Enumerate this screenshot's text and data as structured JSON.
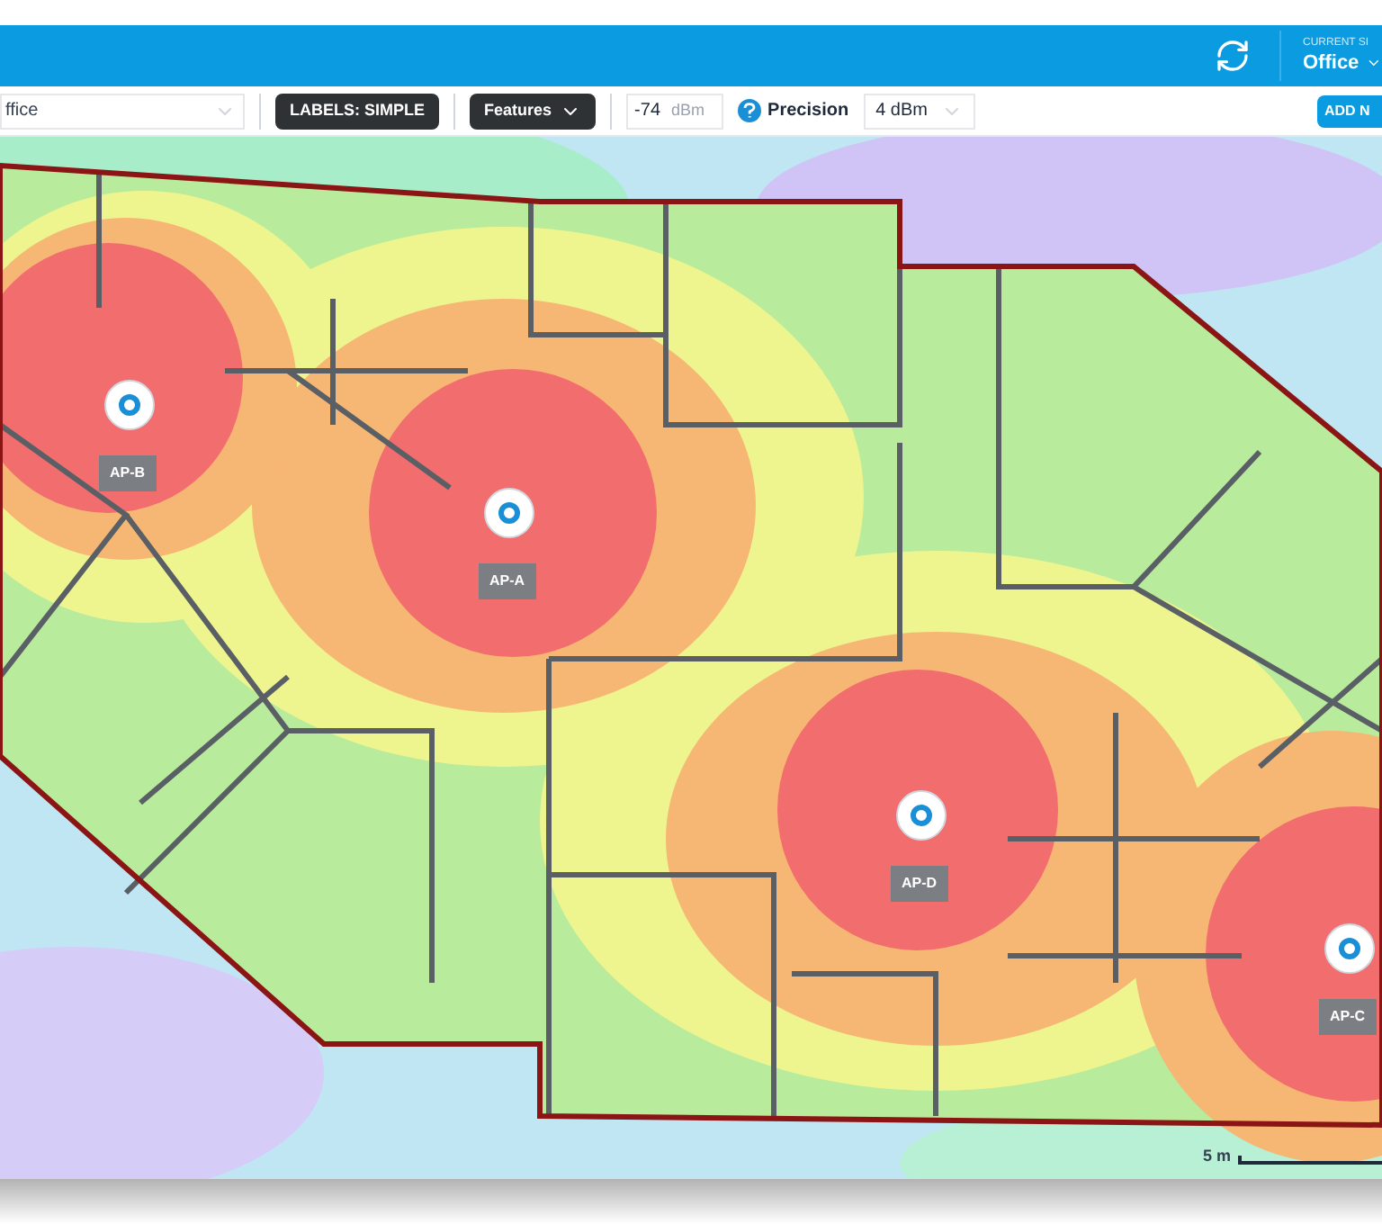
{
  "header": {
    "site_label": "CURRENT SI",
    "site_name": "Office"
  },
  "toolbar": {
    "map_select": "ffice",
    "labels_button": "LABELS: SIMPLE",
    "features_button": "Features",
    "signal_value": "-74",
    "signal_unit": "dBm",
    "precision_label": "Precision",
    "precision_value": "4 dBm",
    "add_button": "ADD N"
  },
  "access_points": [
    {
      "label": "AP-B"
    },
    {
      "label": "AP-A"
    },
    {
      "label": "AP-D"
    },
    {
      "label": "AP-C"
    }
  ],
  "scale": {
    "label": "5 m"
  }
}
